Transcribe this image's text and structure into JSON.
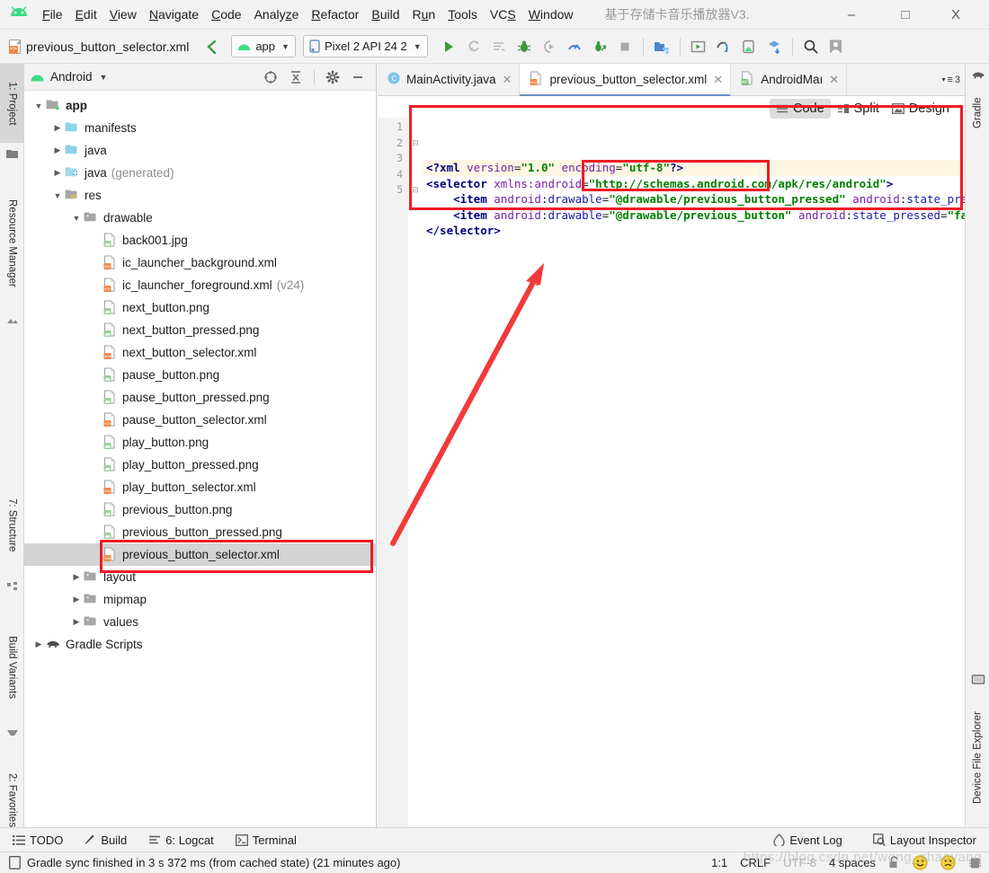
{
  "window": {
    "title": "基于存储卡音乐播放器V3.",
    "app_icon": "android-studio-icon",
    "minimize": "–",
    "maximize": "□",
    "close": "X"
  },
  "menubar": {
    "items": [
      {
        "label": "File",
        "mnemonic": "F"
      },
      {
        "label": "Edit",
        "mnemonic": "E"
      },
      {
        "label": "View",
        "mnemonic": "V"
      },
      {
        "label": "Navigate",
        "mnemonic": "N"
      },
      {
        "label": "Code",
        "mnemonic": "C"
      },
      {
        "label": "Analyze",
        "mnemonic": "z"
      },
      {
        "label": "Refactor",
        "mnemonic": "R"
      },
      {
        "label": "Build",
        "mnemonic": "B"
      },
      {
        "label": "Run",
        "mnemonic": "u"
      },
      {
        "label": "Tools",
        "mnemonic": "T"
      },
      {
        "label": "VCS",
        "mnemonic": "S"
      },
      {
        "label": "Window",
        "mnemonic": "W"
      }
    ]
  },
  "toolbar": {
    "current_file": "previous_button_selector.xml",
    "current_file_icon": "xml-file-icon",
    "back_icon": "navigate-back-icon",
    "module_selector": {
      "label": "app",
      "icon": "android-module-icon",
      "caret": "▼"
    },
    "device_selector": {
      "label": "Pixel 2 API 24 2",
      "icon": "device-icon",
      "caret": "▼"
    },
    "actions": [
      {
        "name": "run-button",
        "glyph": "▶",
        "color": "#3c9a3c"
      },
      {
        "name": "apply-changes-icon",
        "glyph": "⟳",
        "color": "#b0b0b0"
      },
      {
        "name": "run-with-coverage-icon",
        "glyph": "≡",
        "color": "#b0b0b0"
      },
      {
        "name": "debug-icon",
        "glyph": "🐞",
        "color": "#3c9a3c"
      },
      {
        "name": "attach-debugger-icon",
        "glyph": "◑",
        "color": "#b0b0b0"
      },
      {
        "name": "profiler-icon",
        "glyph": "◔",
        "color": "#3c7fd6"
      },
      {
        "name": "run-anything-icon",
        "glyph": "⇗",
        "color": "#3c9a3c"
      },
      {
        "name": "stop-button",
        "glyph": "■",
        "color": "#9a9a9a"
      },
      {
        "name": "sdk-manager-icon",
        "glyph": "▤",
        "color": "#3c7fd6"
      },
      {
        "name": "avd-manager-icon",
        "glyph": "▣",
        "color": "#3c9a3c"
      },
      {
        "name": "sync-project-icon",
        "glyph": "↯",
        "color": "#3c7fd6"
      },
      {
        "name": "device-file-explorer-icon",
        "glyph": "▯",
        "color": "#3c9a3c"
      },
      {
        "name": "layout-inspector-icon",
        "glyph": "⬙",
        "color": "#3c7fd6"
      },
      {
        "name": "search-everywhere-icon",
        "glyph": "⌕",
        "color": "#4a4a4a"
      },
      {
        "name": "account-icon",
        "glyph": "👤",
        "color": "#8d8d8d"
      }
    ]
  },
  "left_rail": {
    "tabs": [
      {
        "label": "1: Project",
        "icon": "project-folder-icon",
        "active": true
      },
      {
        "label": "Resource Manager",
        "icon": "resource-manager-icon",
        "active": false
      },
      {
        "label": "7: Structure",
        "icon": "structure-icon",
        "active": false
      },
      {
        "label": "Build Variants",
        "icon": "build-variants-icon",
        "active": false
      },
      {
        "label": "2: Favorites",
        "icon": "favorites-star-icon",
        "active": false
      }
    ]
  },
  "right_rail": {
    "tabs": [
      {
        "label": "Gradle",
        "icon": "gradle-elephant-icon"
      },
      {
        "label": "Device File Explorer",
        "icon": "device-monitor-icon"
      }
    ]
  },
  "project_panel": {
    "header": {
      "title": "Android",
      "icon": "android-head-icon",
      "caret": "▼",
      "tools": [
        {
          "name": "select-opened-file-icon",
          "glyph": "⊕"
        },
        {
          "name": "collapse-all-icon",
          "glyph": "⤒"
        },
        {
          "name": "settings-gear-icon",
          "glyph": "⚙"
        },
        {
          "name": "hide-panel-icon",
          "glyph": "—"
        }
      ]
    },
    "tree": [
      {
        "label": "app",
        "indent": 0,
        "arrow": "▼",
        "icon": "module-folder-icon",
        "bold": true,
        "sub": ""
      },
      {
        "label": "manifests",
        "indent": 1,
        "arrow": "▶",
        "icon": "folder-blue-icon",
        "bold": false,
        "sub": ""
      },
      {
        "label": "java",
        "indent": 1,
        "arrow": "▶",
        "icon": "folder-blue-icon",
        "bold": false,
        "sub": ""
      },
      {
        "label": "java",
        "indent": 1,
        "arrow": "▶",
        "icon": "folder-generated-icon",
        "bold": false,
        "sub": "(generated)"
      },
      {
        "label": "res",
        "indent": 1,
        "arrow": "▼",
        "icon": "folder-res-icon",
        "bold": false,
        "sub": ""
      },
      {
        "label": "drawable",
        "indent": 2,
        "arrow": "▼",
        "icon": "folder-grey-icon",
        "bold": false,
        "sub": ""
      },
      {
        "label": "back001.jpg",
        "indent": 3,
        "arrow": "",
        "icon": "image-file-icon",
        "bold": false,
        "sub": ""
      },
      {
        "label": "ic_launcher_background.xml",
        "indent": 3,
        "arrow": "",
        "icon": "xml-file-icon",
        "bold": false,
        "sub": ""
      },
      {
        "label": "ic_launcher_foreground.xml",
        "indent": 3,
        "arrow": "",
        "icon": "xml-file-icon",
        "bold": false,
        "sub": "(v24)"
      },
      {
        "label": "next_button.png",
        "indent": 3,
        "arrow": "",
        "icon": "image-file-icon",
        "bold": false,
        "sub": ""
      },
      {
        "label": "next_button_pressed.png",
        "indent": 3,
        "arrow": "",
        "icon": "image-file-icon",
        "bold": false,
        "sub": ""
      },
      {
        "label": "next_button_selector.xml",
        "indent": 3,
        "arrow": "",
        "icon": "xml-file-icon",
        "bold": false,
        "sub": ""
      },
      {
        "label": "pause_button.png",
        "indent": 3,
        "arrow": "",
        "icon": "image-file-icon",
        "bold": false,
        "sub": ""
      },
      {
        "label": "pause_button_pressed.png",
        "indent": 3,
        "arrow": "",
        "icon": "image-file-icon",
        "bold": false,
        "sub": ""
      },
      {
        "label": "pause_button_selector.xml",
        "indent": 3,
        "arrow": "",
        "icon": "xml-file-icon",
        "bold": false,
        "sub": ""
      },
      {
        "label": "play_button.png",
        "indent": 3,
        "arrow": "",
        "icon": "image-file-icon",
        "bold": false,
        "sub": ""
      },
      {
        "label": "play_button_pressed.png",
        "indent": 3,
        "arrow": "",
        "icon": "image-file-icon",
        "bold": false,
        "sub": ""
      },
      {
        "label": "play_button_selector.xml",
        "indent": 3,
        "arrow": "",
        "icon": "xml-file-icon",
        "bold": false,
        "sub": ""
      },
      {
        "label": "previous_button.png",
        "indent": 3,
        "arrow": "",
        "icon": "image-file-icon",
        "bold": false,
        "sub": ""
      },
      {
        "label": "previous_button_pressed.png",
        "indent": 3,
        "arrow": "",
        "icon": "image-file-icon",
        "bold": false,
        "sub": ""
      },
      {
        "label": "previous_button_selector.xml",
        "indent": 3,
        "arrow": "",
        "icon": "xml-file-icon",
        "bold": false,
        "sub": "",
        "selected": true
      },
      {
        "label": "layout",
        "indent": 2,
        "arrow": "▶",
        "icon": "folder-grey-icon",
        "bold": false,
        "sub": ""
      },
      {
        "label": "mipmap",
        "indent": 2,
        "arrow": "▶",
        "icon": "folder-grey-icon",
        "bold": false,
        "sub": ""
      },
      {
        "label": "values",
        "indent": 2,
        "arrow": "▶",
        "icon": "folder-grey-icon",
        "bold": false,
        "sub": ""
      },
      {
        "label": "Gradle Scripts",
        "indent": 0,
        "arrow": "▶",
        "icon": "gradle-elephant-icon",
        "bold": false,
        "sub": ""
      }
    ]
  },
  "editor": {
    "tabs": [
      {
        "label": "MainActivity.java",
        "icon": "java-class-icon",
        "active": false,
        "close": "✕"
      },
      {
        "label": "previous_button_selector.xml",
        "icon": "xml-file-icon",
        "active": true,
        "close": "✕"
      },
      {
        "label": "AndroidMaı",
        "icon": "manifest-file-icon",
        "active": false,
        "close": "✕"
      }
    ],
    "tab_overflow": {
      "caret": "▾",
      "glyph": "≡",
      "count": "3"
    },
    "view_modes": [
      {
        "label": "Code",
        "icon": "code-view-icon",
        "active": true
      },
      {
        "label": "Split",
        "icon": "split-view-icon",
        "active": false
      },
      {
        "label": "Design",
        "icon": "design-view-icon",
        "active": false
      }
    ],
    "inspection_status": "✔",
    "line_numbers": [
      "1",
      "2",
      "3",
      "4",
      "5"
    ],
    "code_lines": [
      {
        "number": "1",
        "highlighted": true,
        "tokens": [
          {
            "t": "<?xml ",
            "c": "pi"
          },
          {
            "t": "version",
            "c": "attr"
          },
          {
            "t": "=",
            "c": "plain"
          },
          {
            "t": "\"1.0\"",
            "c": "val"
          },
          {
            "t": " ",
            "c": "plain"
          },
          {
            "t": "encoding",
            "c": "attr"
          },
          {
            "t": "=",
            "c": "plain"
          },
          {
            "t": "\"utf-8\"",
            "c": "val"
          },
          {
            "t": "?>",
            "c": "pi"
          }
        ]
      },
      {
        "number": "2",
        "highlighted": false,
        "tokens": [
          {
            "t": "<selector ",
            "c": "tag"
          },
          {
            "t": "xmlns:android",
            "c": "attr"
          },
          {
            "t": "=",
            "c": "plain"
          },
          {
            "t": "\"http://schemas.android.com/apk/res/android\"",
            "c": "val"
          },
          {
            "t": ">",
            "c": "tag"
          }
        ]
      },
      {
        "number": "3",
        "highlighted": false,
        "tokens": [
          {
            "t": "    <item ",
            "c": "tag"
          },
          {
            "t": "android",
            "c": "attr"
          },
          {
            "t": ":",
            "c": "plain"
          },
          {
            "t": "drawable",
            "c": "ns"
          },
          {
            "t": "=",
            "c": "plain"
          },
          {
            "t": "\"@drawable/previous_button_pressed\"",
            "c": "val"
          },
          {
            "t": " ",
            "c": "plain"
          },
          {
            "t": "android",
            "c": "attr"
          },
          {
            "t": ":",
            "c": "plain"
          },
          {
            "t": "state_pressed",
            "c": "ns"
          },
          {
            "t": "=",
            "c": "plain"
          },
          {
            "t": "\"true\"",
            "c": "val"
          },
          {
            "t": " />",
            "c": "tag"
          }
        ]
      },
      {
        "number": "4",
        "highlighted": false,
        "tokens": [
          {
            "t": "    <item ",
            "c": "tag"
          },
          {
            "t": "android",
            "c": "attr"
          },
          {
            "t": ":",
            "c": "plain"
          },
          {
            "t": "drawable",
            "c": "ns"
          },
          {
            "t": "=",
            "c": "plain"
          },
          {
            "t": "\"@drawable/previous_button\"",
            "c": "val"
          },
          {
            "t": " ",
            "c": "plain"
          },
          {
            "t": "android",
            "c": "attr"
          },
          {
            "t": ":",
            "c": "plain"
          },
          {
            "t": "state_pressed",
            "c": "ns"
          },
          {
            "t": "=",
            "c": "plain"
          },
          {
            "t": "\"false\"",
            "c": "val"
          },
          {
            "t": " />",
            "c": "tag"
          }
        ]
      },
      {
        "number": "5",
        "highlighted": false,
        "tokens": [
          {
            "t": "</selector>",
            "c": "tag"
          }
        ]
      }
    ],
    "fold_markers": [
      "",
      "⊟",
      "",
      "",
      "⊟"
    ]
  },
  "annotations": {
    "box_color": "#ee1c25",
    "arrow_color": "#f23a3a",
    "boxes": [
      {
        "name": "code-block-highlight"
      },
      {
        "name": "drawable-value-highlight"
      },
      {
        "name": "selected-file-highlight"
      }
    ],
    "arrow": {
      "name": "pointer-arrow"
    }
  },
  "toolwindow_bar": {
    "left": [
      {
        "label": "TODO",
        "icon": "todo-list-icon"
      },
      {
        "label": "Build",
        "icon": "build-hammer-icon"
      },
      {
        "label": "6: Logcat",
        "icon": "logcat-icon"
      },
      {
        "label": "Terminal",
        "icon": "terminal-icon"
      }
    ],
    "right": [
      {
        "label": "Event Log",
        "icon": "event-log-icon"
      },
      {
        "label": "Layout Inspector",
        "icon": "layout-inspector-icon"
      }
    ]
  },
  "statusbar": {
    "icon": "status-doc-icon",
    "message": "Gradle sync finished in 3 s 372 ms (from cached state) (21 minutes ago)",
    "caret_position": "1:1",
    "line_separator": "CRLF",
    "encoding": "UTF-8",
    "indent": "4 spaces",
    "lock_icon": "unlocked-padlock-icon",
    "smiley_icon": "happy-face-icon",
    "frowny_icon": "sad-face-icon",
    "memory_icon": "memory-indicator-icon"
  },
  "watermark": {
    "text": "https://blog.csdn.net/wong_shaoyang"
  }
}
